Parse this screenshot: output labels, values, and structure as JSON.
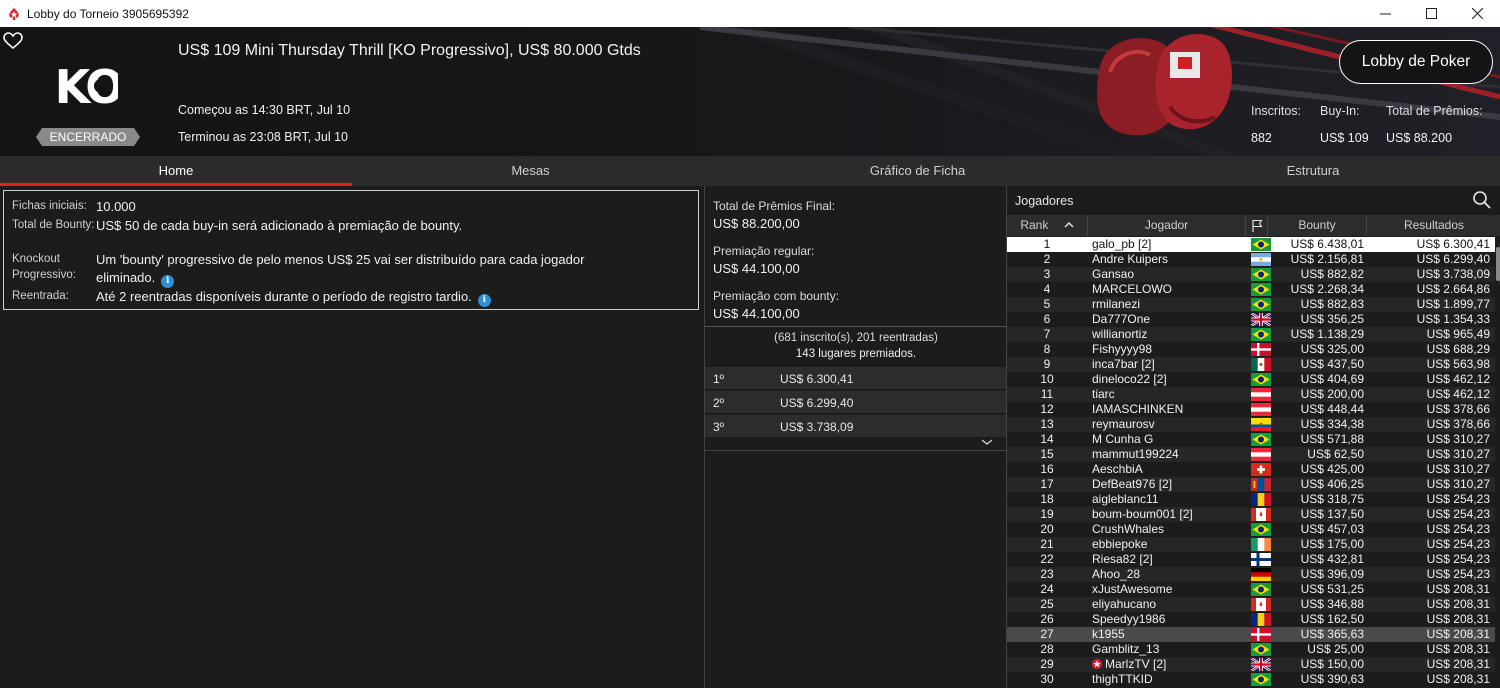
{
  "window": {
    "title": "Lobby do Torneio 3905695392",
    "minimize_icon": "minimize-icon",
    "maximize_icon": "maximize-icon",
    "close_icon": "close-icon"
  },
  "header": {
    "tournament_name": "US$ 109 Mini Thursday Thrill [KO Progressivo], US$ 80.000 Gtds",
    "logo_text": "KO",
    "status": "ENCERRADO",
    "started": "Começou as 14:30 BRT, Jul 10",
    "ended": "Terminou as 23:08 BRT, Jul 10",
    "lobby_button": "Lobby de Poker",
    "stats": [
      {
        "label": "Inscritos:",
        "value": "882"
      },
      {
        "label": "Buy-In:",
        "value": "US$ 109"
      },
      {
        "label": "Total de Prêmios:",
        "value": "US$ 88.200"
      }
    ]
  },
  "tabs": [
    "Home",
    "Mesas",
    "Gráfico de Ficha",
    "Estrutura"
  ],
  "info": [
    {
      "label": "Fichas iniciais:",
      "value": "10.000"
    },
    {
      "label": "Total de Bounty:",
      "value": "US$ 50 de cada buy-in será adicionado à premiação de bounty."
    },
    {
      "label": "Knockout Progressivo:",
      "value": "Um 'bounty' progressivo de pelo menos US$ 25 vai ser distribuído para cada jogador eliminado."
    },
    {
      "label": "Reentrada:",
      "value": "Até 2 reentradas disponíveis durante o período de registro tardio."
    }
  ],
  "prizes": {
    "total_label": "Total de Prêmios Final:",
    "total_value": "US$ 88.200,00",
    "regular_label": "Premiação regular:",
    "regular_value": "US$ 44.100,00",
    "bounty_label": "Premiação com bounty:",
    "bounty_value": "US$ 44.100,00",
    "entries": "(681 inscrito(s), 201 reentradas)",
    "places": "143 lugares premiados.",
    "rows": [
      {
        "pos": "1º",
        "amount": "US$ 6.300,41"
      },
      {
        "pos": "2º",
        "amount": "US$ 6.299,40"
      },
      {
        "pos": "3º",
        "amount": "US$ 3.738,09"
      }
    ]
  },
  "players": {
    "title": "Jogadores",
    "headers": {
      "rank": "Rank",
      "player": "Jogador",
      "bounty": "Bounty",
      "results": "Resultados"
    },
    "rows": [
      {
        "rank": "1",
        "name": "galo_pb [2]",
        "flag": "br",
        "bounty": "US$ 6.438,01",
        "result": "US$ 6.300,41"
      },
      {
        "rank": "2",
        "name": "Andre Kuipers",
        "flag": "ar",
        "bounty": "US$ 2.156,81",
        "result": "US$ 6.299,40"
      },
      {
        "rank": "3",
        "name": "Gansao",
        "flag": "br",
        "bounty": "US$ 882,82",
        "result": "US$ 3.738,09"
      },
      {
        "rank": "4",
        "name": "MARCELOWO",
        "flag": "br",
        "bounty": "US$ 2.268,34",
        "result": "US$ 2.664,86"
      },
      {
        "rank": "5",
        "name": "rmilanezi",
        "flag": "br",
        "bounty": "US$ 882,83",
        "result": "US$ 1.899,77"
      },
      {
        "rank": "6",
        "name": "Da777One",
        "flag": "gb",
        "bounty": "US$ 356,25",
        "result": "US$ 1.354,33"
      },
      {
        "rank": "7",
        "name": "willianortiz",
        "flag": "br",
        "bounty": "US$ 1.138,29",
        "result": "US$ 965,49"
      },
      {
        "rank": "8",
        "name": "Fishyyyy98",
        "flag": "dk",
        "bounty": "US$ 325,00",
        "result": "US$ 688,29"
      },
      {
        "rank": "9",
        "name": "inca7bar [2]",
        "flag": "mx",
        "bounty": "US$ 437,50",
        "result": "US$ 563,98"
      },
      {
        "rank": "10",
        "name": "dineloco22 [2]",
        "flag": "br",
        "bounty": "US$ 404,69",
        "result": "US$ 462,12"
      },
      {
        "rank": "11",
        "name": "tiarc",
        "flag": "at",
        "bounty": "US$ 200,00",
        "result": "US$ 462,12"
      },
      {
        "rank": "12",
        "name": "IAMASCHINKEN",
        "flag": "at",
        "bounty": "US$ 448,44",
        "result": "US$ 378,66"
      },
      {
        "rank": "13",
        "name": "reymaurosv",
        "flag": "ec",
        "bounty": "US$ 334,38",
        "result": "US$ 378,66"
      },
      {
        "rank": "14",
        "name": "M Cunha G",
        "flag": "br",
        "bounty": "US$ 571,88",
        "result": "US$ 310,27"
      },
      {
        "rank": "15",
        "name": "mammut199224",
        "flag": "at",
        "bounty": "US$ 62,50",
        "result": "US$ 310,27"
      },
      {
        "rank": "16",
        "name": "AeschbiA",
        "flag": "ch",
        "bounty": "US$ 425,00",
        "result": "US$ 310,27"
      },
      {
        "rank": "17",
        "name": "DefBeat976 [2]",
        "flag": "mn",
        "bounty": "US$ 406,25",
        "result": "US$ 310,27"
      },
      {
        "rank": "18",
        "name": "aigleblanc11",
        "flag": "ro",
        "bounty": "US$ 318,75",
        "result": "US$ 254,23"
      },
      {
        "rank": "19",
        "name": "boum-boum001 [2]",
        "flag": "ca",
        "bounty": "US$ 137,50",
        "result": "US$ 254,23"
      },
      {
        "rank": "20",
        "name": "CrushWhales",
        "flag": "br",
        "bounty": "US$ 457,03",
        "result": "US$ 254,23"
      },
      {
        "rank": "21",
        "name": "ebbiepoke",
        "flag": "ie",
        "bounty": "US$ 175,00",
        "result": "US$ 254,23"
      },
      {
        "rank": "22",
        "name": "Riesa82 [2]",
        "flag": "fi",
        "bounty": "US$ 432,81",
        "result": "US$ 254,23"
      },
      {
        "rank": "23",
        "name": "Ahoo_28",
        "flag": "de",
        "bounty": "US$ 396,09",
        "result": "US$ 254,23"
      },
      {
        "rank": "24",
        "name": "xJustAwesome",
        "flag": "br",
        "bounty": "US$ 531,25",
        "result": "US$ 208,31"
      },
      {
        "rank": "25",
        "name": "eliyahucano",
        "flag": "ca",
        "bounty": "US$ 346,88",
        "result": "US$ 208,31"
      },
      {
        "rank": "26",
        "name": "Speedyy1986",
        "flag": "ro",
        "bounty": "US$ 162,50",
        "result": "US$ 208,31"
      },
      {
        "rank": "27",
        "name": "k1955",
        "flag": "dk",
        "bounty": "US$ 365,63",
        "result": "US$ 208,31"
      },
      {
        "rank": "28",
        "name": "Gamblitz_13",
        "flag": "br",
        "bounty": "US$ 25,00",
        "result": "US$ 208,31"
      },
      {
        "rank": "29",
        "name": "MarlzTV [2]",
        "flag": "gb",
        "bounty": "US$ 150,00",
        "result": "US$ 208,31",
        "star": true
      },
      {
        "rank": "30",
        "name": "thighTTKID",
        "flag": "br",
        "bounty": "US$ 390,63",
        "result": "US$ 208,31"
      }
    ]
  },
  "colors": {
    "accent": "#d9232e",
    "header_bg": "#141416",
    "panel_bg": "#1c1c1c",
    "selected_row": "#ffffff"
  }
}
